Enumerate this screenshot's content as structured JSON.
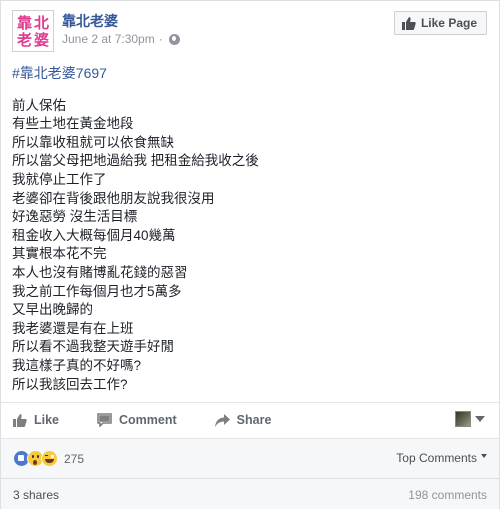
{
  "page": {
    "name": "靠北老婆",
    "avatar_chars": [
      "靠",
      "北",
      "老",
      "婆"
    ],
    "timestamp": "June 2 at 7:30pm",
    "separator": "·",
    "like_page_label": "Like Page"
  },
  "post": {
    "hashtag": "#靠北老婆7697",
    "lines": [
      "前人保佑",
      "有些土地在黃金地段",
      "所以靠收租就可以依食無缺",
      "所以當父母把地過給我 把租金給我收之後",
      "我就停止工作了",
      "老婆卻在背後跟他朋友說我很沒用",
      "好逸惡勞 沒生活目標",
      "租金收入大概每個月40幾萬",
      "其實根本花不完",
      "本人也沒有賭博亂花錢的惡習",
      "我之前工作每個月也才5萬多",
      "又早出晚歸的",
      "我老婆還是有在上班",
      "所以看不過我整天遊手好閒",
      "我這樣子真的不好嗎?",
      "所以我該回去工作?"
    ]
  },
  "actions": {
    "like_label": "Like",
    "comment_label": "Comment",
    "share_label": "Share"
  },
  "reactions": {
    "types": [
      "like",
      "wow",
      "haha"
    ],
    "count": "275",
    "sort_label": "Top Comments"
  },
  "footer": {
    "shares": "3 shares",
    "comments": "198 comments"
  },
  "colors": {
    "link": "#365899",
    "meta": "#90949c",
    "action": "#616770",
    "avatar_text": "#e0398f"
  }
}
